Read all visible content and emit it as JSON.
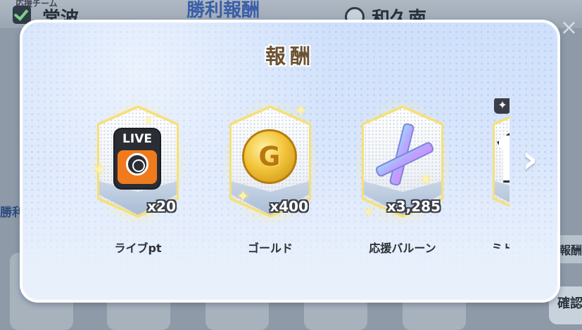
{
  "background": {
    "top_small_label": "応援チーム",
    "team_checked_label": "常波",
    "header_title": "勝利報酬",
    "team_other_label": "和久南",
    "left_label": "勝利",
    "right_label": "報酬",
    "confirm_label": "確認",
    "close_glyph": "×"
  },
  "dialog": {
    "title": "報酬",
    "rewards": [
      {
        "label": "ライブpt",
        "quantity": "x20",
        "icon": "live-ticket-icon"
      },
      {
        "label": "ゴールド",
        "quantity": "x400",
        "icon": "gold-coin-icon"
      },
      {
        "label": "応援バルーン",
        "quantity": "x3,285",
        "icon": "cheer-balloon-icon"
      },
      {
        "label": "ミド",
        "quantity": "",
        "icon": "uniform-shirt-icon"
      }
    ],
    "next_glyph": "›",
    "live_text": "LIVE",
    "coin_letter": "G"
  },
  "colors": {
    "title_brown": "#6a5232",
    "dialog_blue": "#cfe0fb",
    "card_gold_glow": "#fff3a6"
  }
}
